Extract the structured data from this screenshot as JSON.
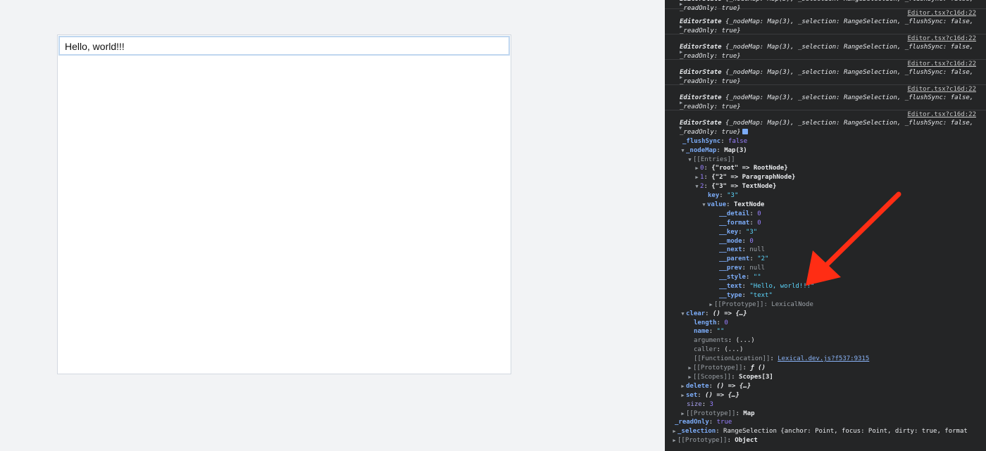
{
  "editor": {
    "text": "Hello, world!!!"
  },
  "console": {
    "source_link": "Editor.tsx?c16d:22",
    "collapsed_entry": {
      "line1_name": "EditorState",
      "line1_rest": " {_nodeMap: Map(3), _selection: RangeSelection, _flushSync: false,",
      "line2": "_readOnly: true}"
    },
    "tree": {
      "flushSync_key": "_flushSync",
      "flushSync_val": "false",
      "nodeMap_key": "_nodeMap",
      "nodeMap_val": "Map(3)",
      "entries_label": "[[Entries]]",
      "entry0": "{\"root\" => RootNode}",
      "entry1": "{\"2\" => ParagraphNode}",
      "entry2": "{\"3\" => TextNode}",
      "key_key": "key",
      "key_val": "\"3\"",
      "value_key": "value",
      "value_val": "TextNode",
      "props": [
        {
          "k": "__detail",
          "v": "0",
          "t": "num"
        },
        {
          "k": "__format",
          "v": "0",
          "t": "num"
        },
        {
          "k": "__key",
          "v": "\"3\"",
          "t": "str"
        },
        {
          "k": "__mode",
          "v": "0",
          "t": "num"
        },
        {
          "k": "__next",
          "v": "null",
          "t": "nul"
        },
        {
          "k": "__parent",
          "v": "\"2\"",
          "t": "str"
        },
        {
          "k": "__prev",
          "v": "null",
          "t": "nul"
        },
        {
          "k": "__style",
          "v": "\"\"",
          "t": "str"
        },
        {
          "k": "__text",
          "v": "\"Hello, world!!!\"",
          "t": "str"
        },
        {
          "k": "__type",
          "v": "\"text\"",
          "t": "str"
        }
      ],
      "proto_lexical": "[[Prototype]]: LexicalNode",
      "clear_key": "clear",
      "clear_val": "() => {…}",
      "length_key": "length",
      "length_val": "0",
      "name_key": "name",
      "name_val": "\"\"",
      "arguments_key": "arguments",
      "arguments_val": "(...)",
      "caller_key": "caller",
      "caller_val": "(...)",
      "funcloc_key": "[[FunctionLocation]]",
      "funcloc_val": "Lexical.dev.js?f537:9315",
      "proto_f_key": "[[Prototype]]",
      "proto_f_val": "ƒ ()",
      "scopes_key": "[[Scopes]]",
      "scopes_val": "Scopes[3]",
      "delete_key": "delete",
      "delete_val": "() => {…}",
      "set_key": "set",
      "set_val": "() => {…}",
      "size_key": "size",
      "size_val": "3",
      "proto_map_key": "[[Prototype]]",
      "proto_map_val": "Map",
      "readonly_key": "_readOnly",
      "readonly_val": "true",
      "selection_key": "_selection",
      "selection_val": "RangeSelection {anchor: Point, focus: Point, dirty: true, format",
      "proto_obj_key": "[[Prototype]]",
      "proto_obj_val": "Object"
    }
  },
  "annotation": {
    "arrow_color": "#ff2d14"
  }
}
